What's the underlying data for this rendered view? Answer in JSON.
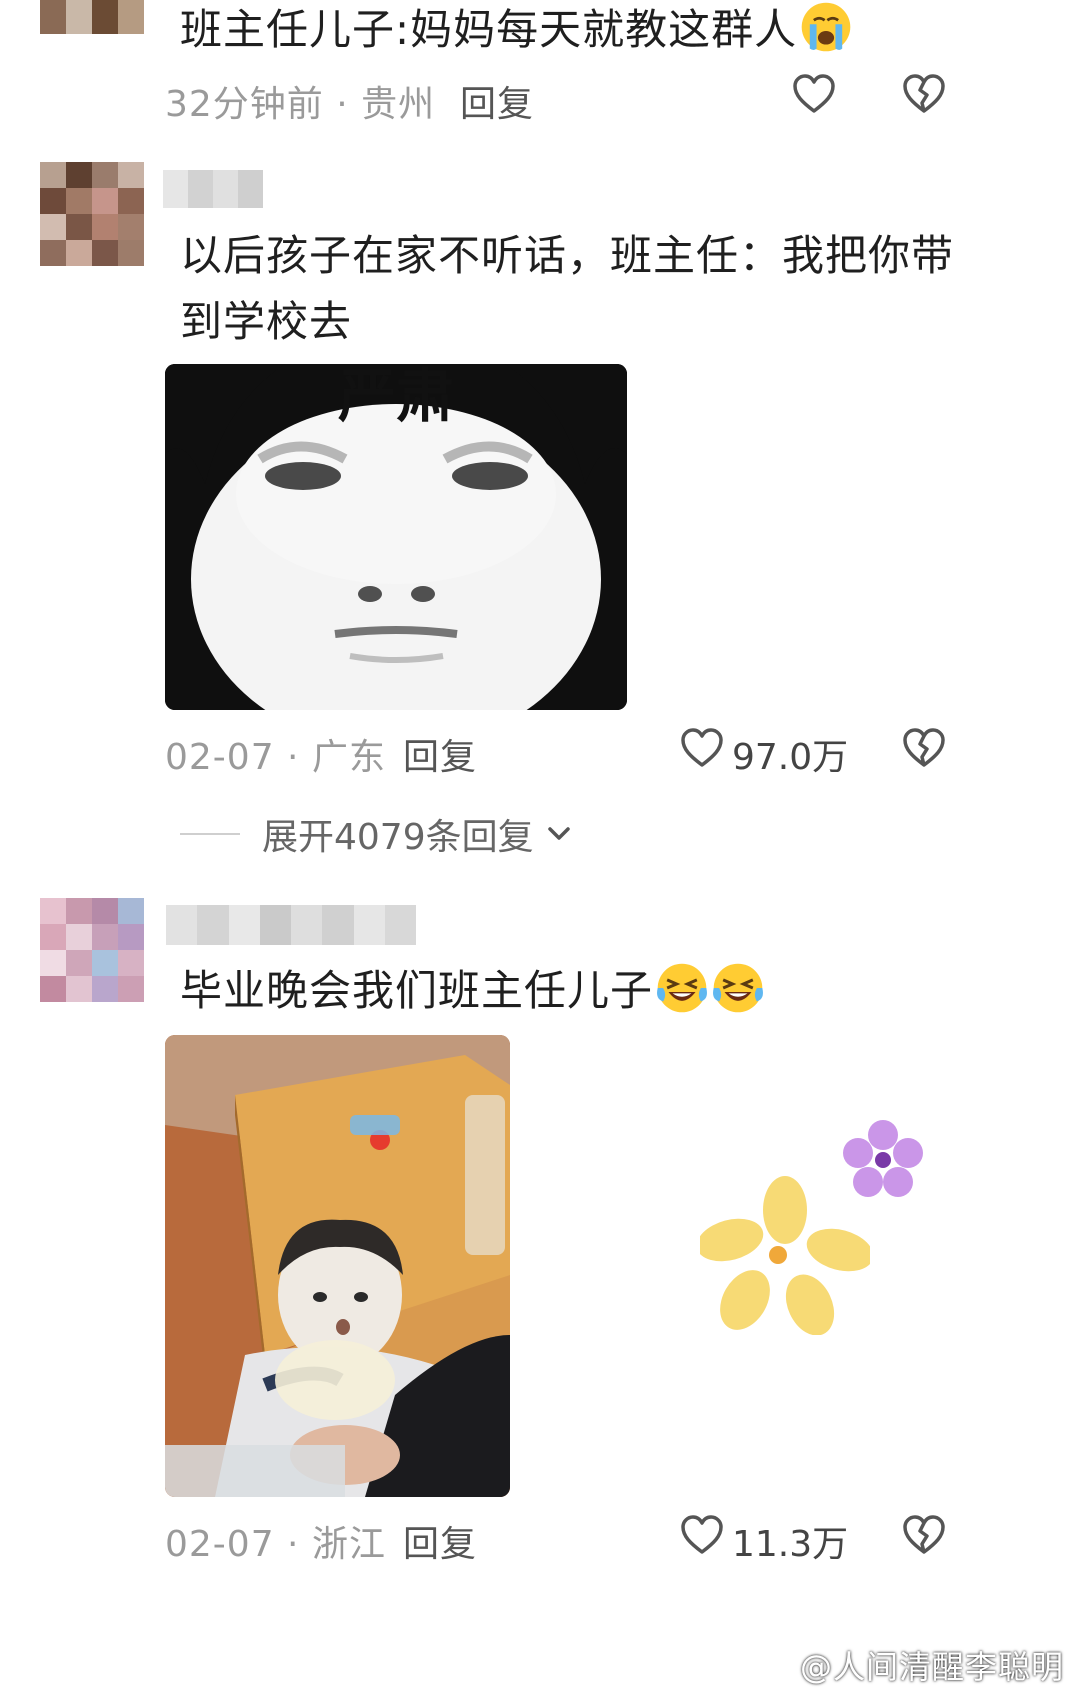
{
  "comments": [
    {
      "text": "班主任儿子:妈妈每天就教这群人",
      "emoji": "crying-face",
      "time": "32分钟前 · 贵州",
      "reply": "回复"
    },
    {
      "text_line1": "以后孩子在家不听话，班主任：我把你带",
      "text_line2": "到学校去",
      "meme_caption": "严肃",
      "time": "02-07 · 广东",
      "reply": "回复",
      "likes": "97.0万",
      "expand": "展开4079条回复"
    },
    {
      "text": "毕业晚会我们班主任儿子",
      "emoji": "laughing-tears-face",
      "time": "02-07 · 浙江",
      "reply": "回复",
      "likes": "11.3万"
    }
  ],
  "watermark": "@人间清醒李聪明",
  "colors": {
    "meta": "#9a9a9a",
    "text": "#1f1f1f",
    "icon": "#555555",
    "flower_yellow": "#f7d76a",
    "flower_purple": "#c58be6"
  },
  "icons": [
    "heart-icon",
    "broken-heart-icon",
    "chevron-down-icon",
    "crying-face-icon",
    "laughing-tears-face-icon"
  ]
}
